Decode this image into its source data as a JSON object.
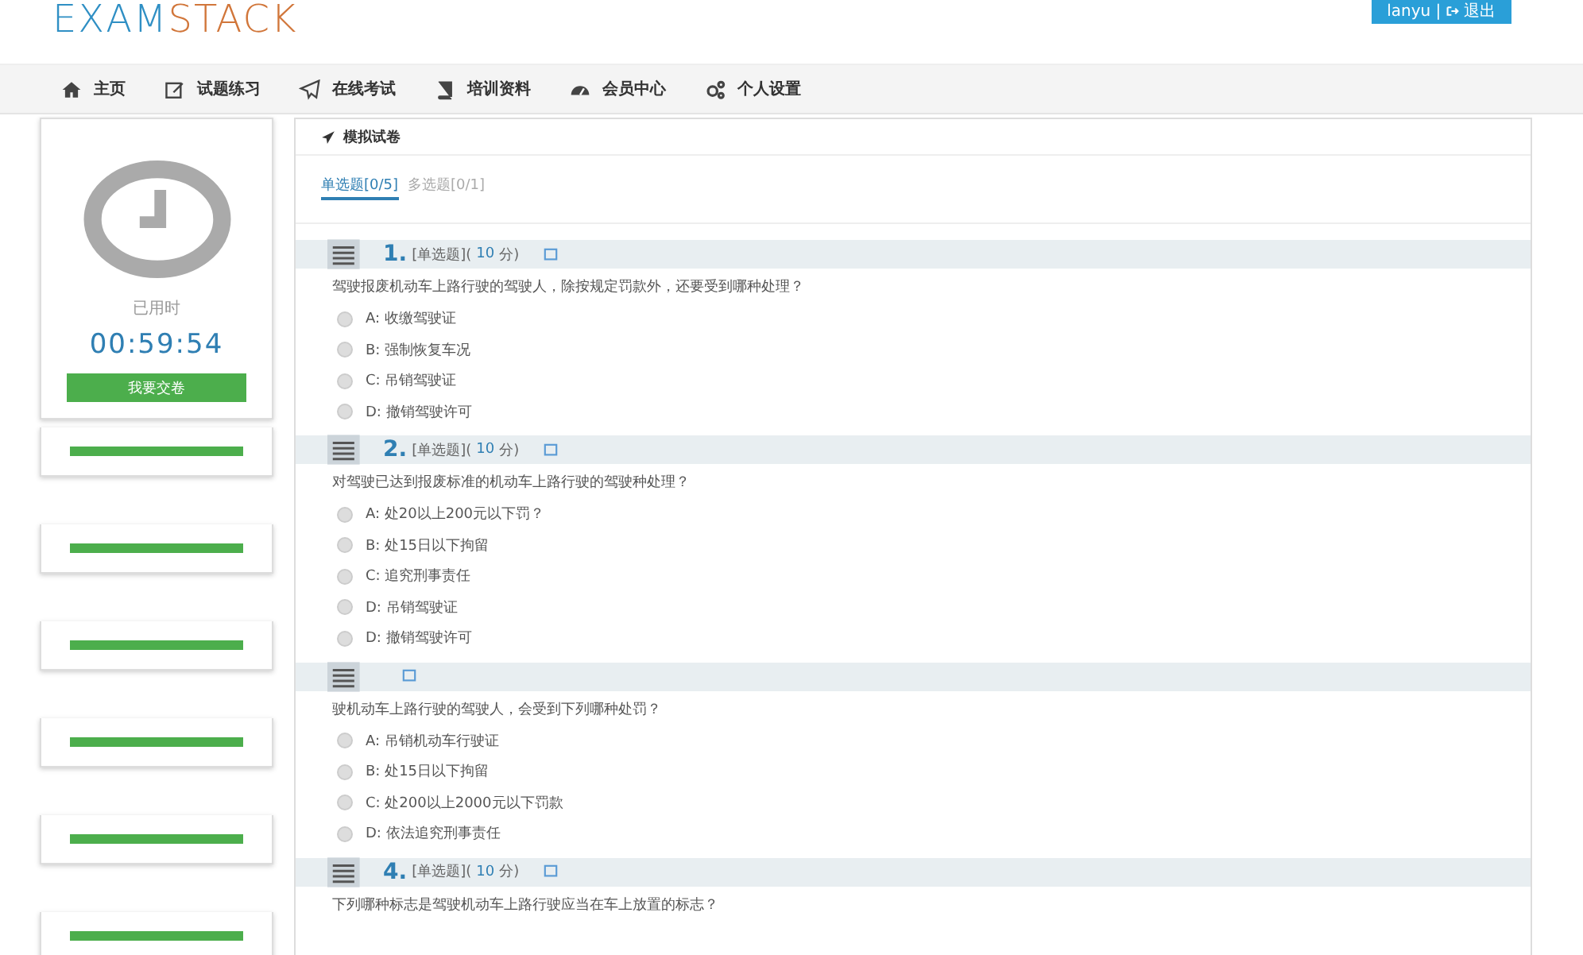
{
  "logo": {
    "left": "EXAM",
    "right": "STACK"
  },
  "user": {
    "name": "lanyu",
    "separator": "|",
    "logout": "退出"
  },
  "nav": [
    {
      "label": "主页"
    },
    {
      "label": "试题练习"
    },
    {
      "label": "在线考试"
    },
    {
      "label": "培训资料"
    },
    {
      "label": "会员中心"
    },
    {
      "label": "个人设置"
    }
  ],
  "timer": {
    "label": "已用时",
    "time": "00:59:54",
    "submit": "我要交卷"
  },
  "side_cards": [
    {
      "kind": "bar"
    },
    {
      "kind": "bar"
    },
    {
      "kind": "bar"
    },
    {
      "kind": "bar"
    },
    {
      "kind": "bar"
    },
    {
      "kind": "bar"
    }
  ],
  "panel": {
    "title": "模拟试卷"
  },
  "tabs": [
    {
      "label": "单选题[0/5]",
      "selected": true
    },
    {
      "label": "多选题[0/1]",
      "selected": false
    }
  ],
  "questions": [
    {
      "number": "1.",
      "type": "[单选题](",
      "score": "10",
      "unit": "分)",
      "text": "驾驶报废机动车上路行驶的驾驶人，除按规定罚款外，还要受到哪种处理？",
      "options": [
        "A: 收缴驾驶证",
        "B: 强制恢复车况",
        "C: 吊销驾驶证",
        "D: 撤销驾驶许可"
      ]
    },
    {
      "number": "2.",
      "type": "[单选题](",
      "score": "10",
      "unit": "分)",
      "text": "对驾驶已达到报废标准的机动车上路行驶的驾驶种处理？",
      "options": [
        "A: 处20以上200元以下罚？",
        "B: 处15日以下拘留",
        "C: 追究刑事责任",
        "D: 吊销驾驶证",
        "D: 撤销驾驶许可"
      ]
    },
    {
      "text": "驶机动车上路行驶的驾驶人，会受到下列哪种处罚？",
      "options": [
        "A: 吊销机动车行驶证",
        "B: 处15日以下拘留",
        "C: 处200以上2000元以下罚款",
        "D: 依法追究刑事责任"
      ]
    },
    {
      "number": "4.",
      "type": "[单选题](",
      "score": "10",
      "unit": "分)",
      "text": "下列哪种标志是驾驶机动车上路行驶应当在车上放置的标志？"
    }
  ]
}
